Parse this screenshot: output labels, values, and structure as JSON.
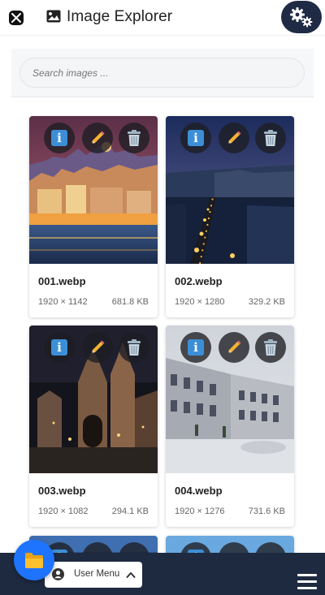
{
  "header": {
    "title": "Image Explorer",
    "logo_icon": "app-logo-icon",
    "title_icon": "image-icon",
    "settings_icon": "gears-icon"
  },
  "search": {
    "placeholder": "Search images ..."
  },
  "cards": [
    {
      "name": "001.webp",
      "dims": "1920 × 1142",
      "size": "681.8 KB"
    },
    {
      "name": "002.webp",
      "dims": "1920 × 1280",
      "size": "329.2 KB"
    },
    {
      "name": "003.webp",
      "dims": "1920 × 1082",
      "size": "294.1 KB"
    },
    {
      "name": "004.webp",
      "dims": "1920 × 1276",
      "size": "731.6 KB"
    }
  ],
  "card_action_icons": [
    "info-icon",
    "pencil-icon",
    "trash-icon"
  ],
  "bottom_bar": {
    "user_menu_label": "User Menu",
    "fab_icon": "folder-icon",
    "menu_icon": "hamburger-icon"
  },
  "colors": {
    "header_settings_bg": "#1f2a44",
    "bottom_bar_bg": "#1e2a40",
    "fab_bg": "#1e74ff",
    "info_blue": "#3c8fd6"
  }
}
